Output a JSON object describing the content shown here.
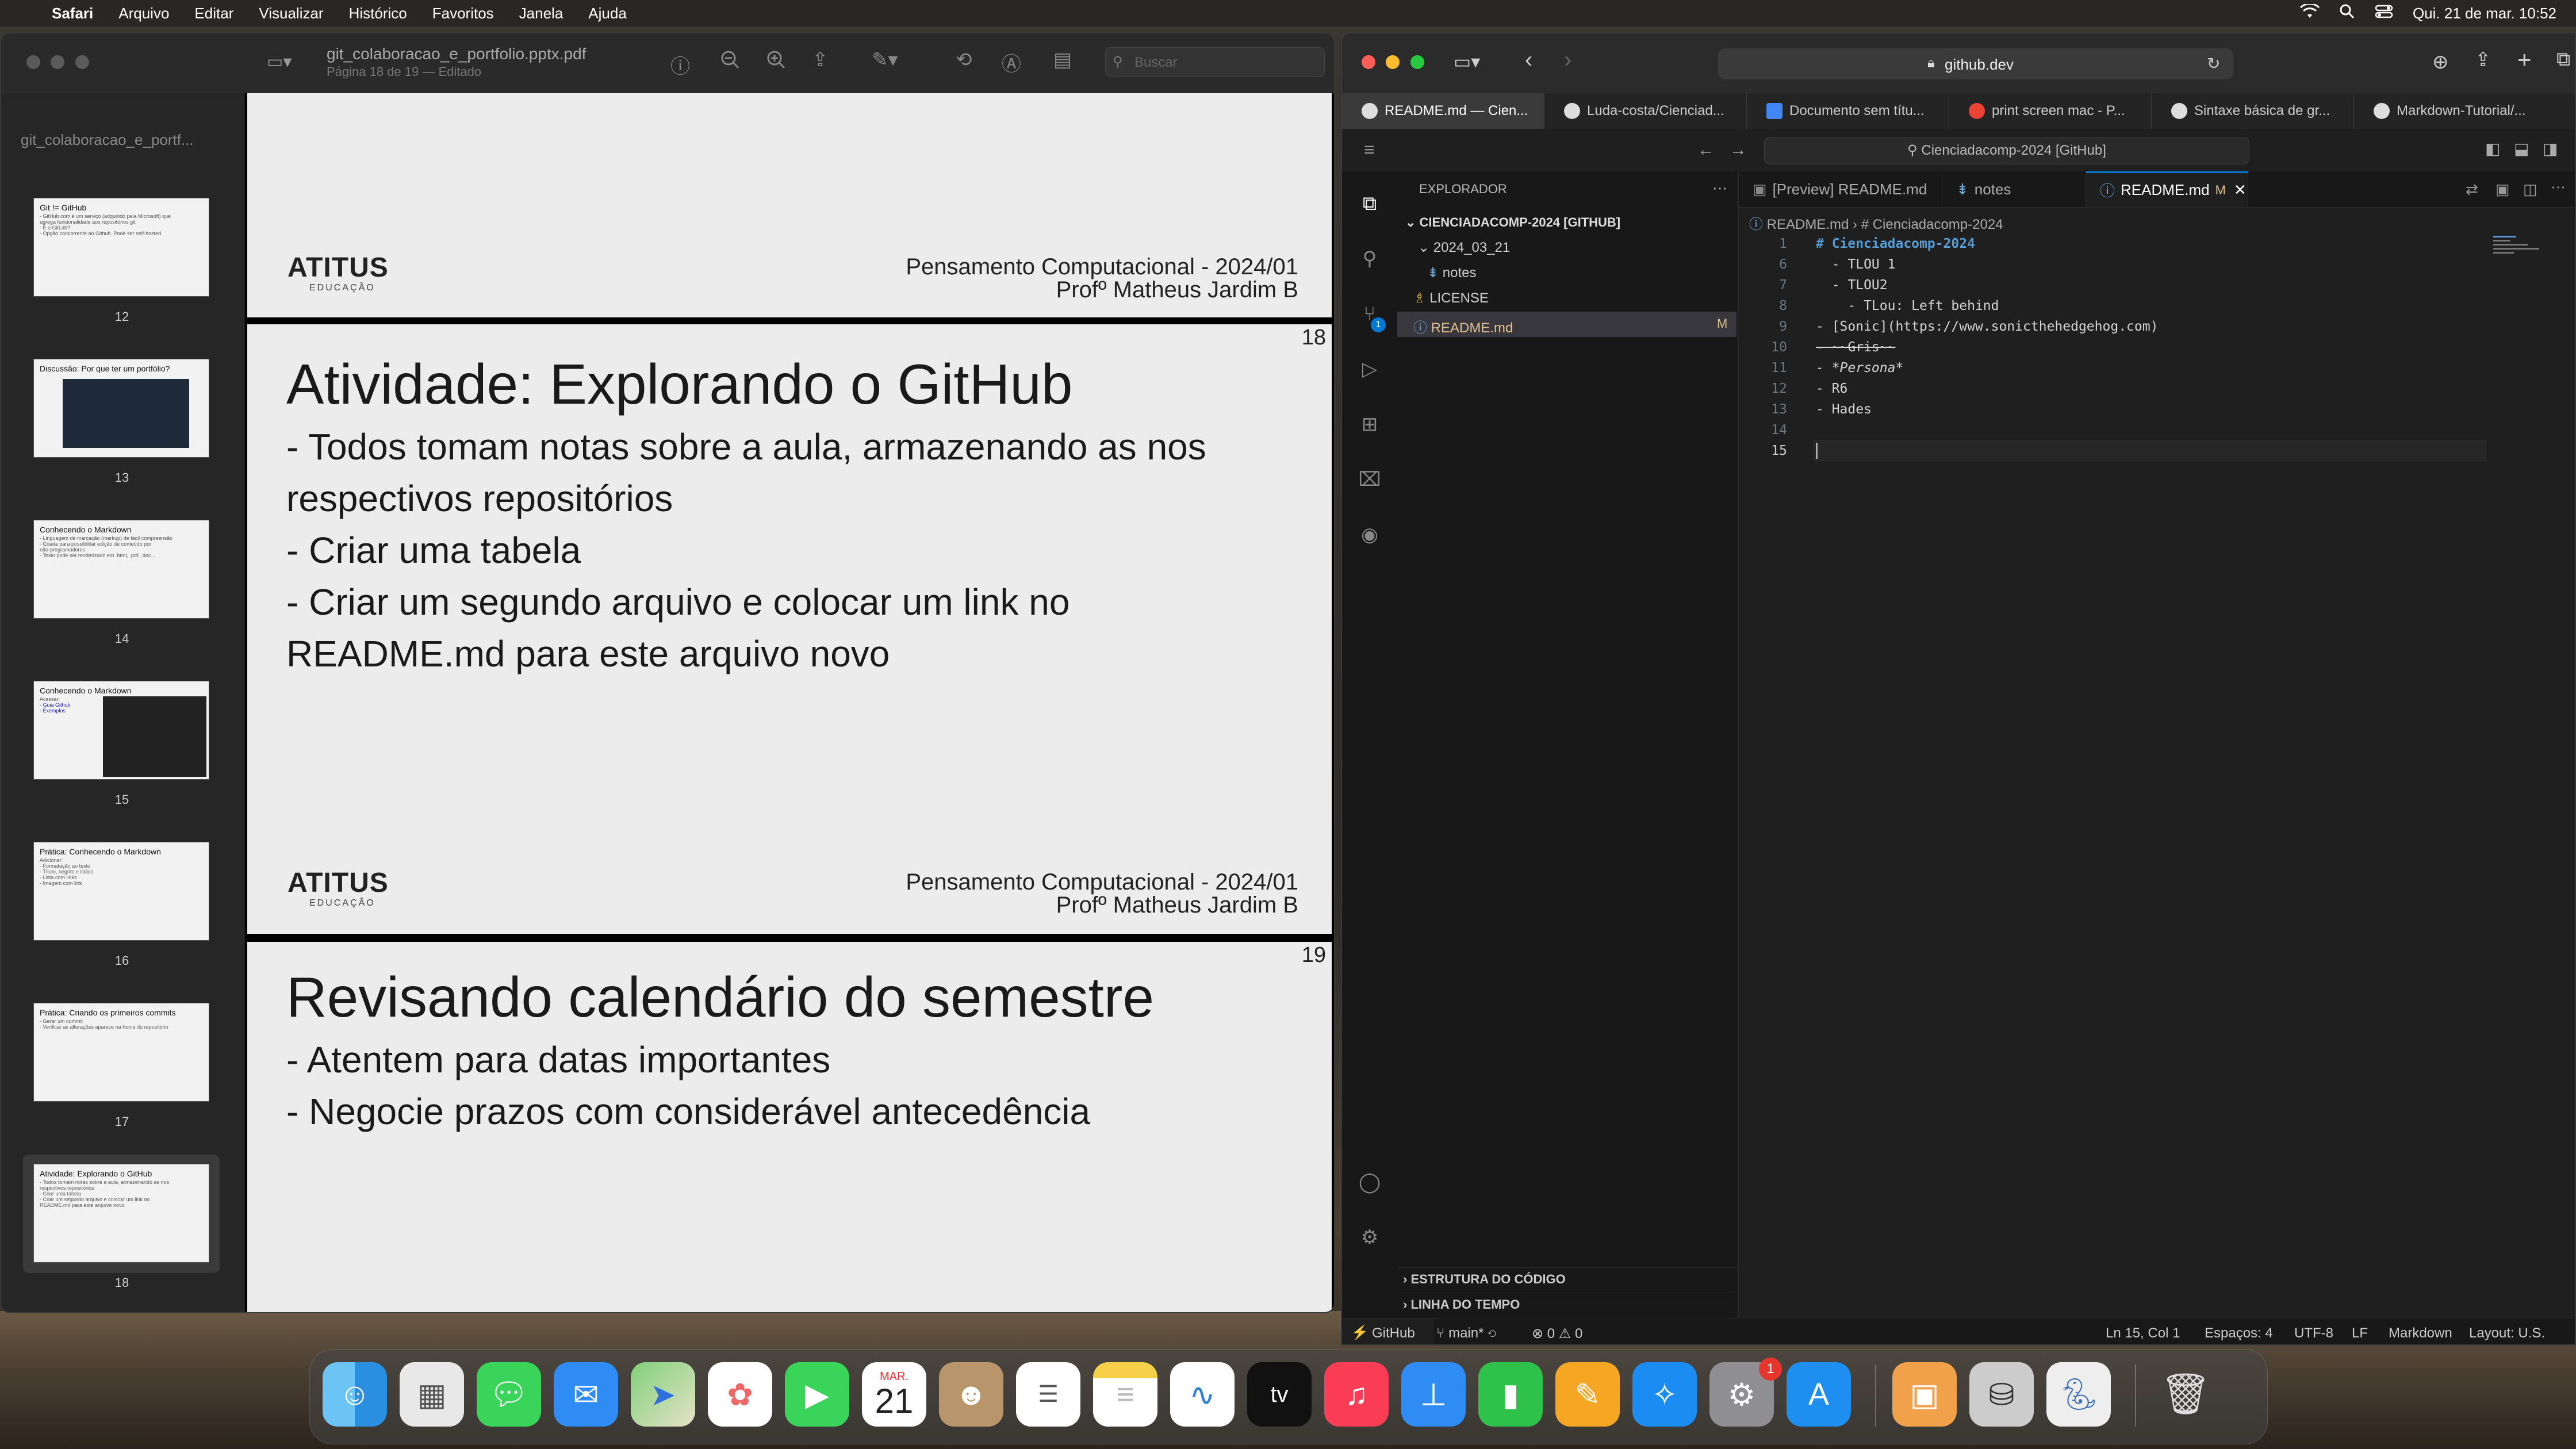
{
  "menubar": {
    "app": "Safari",
    "items": [
      "Arquivo",
      "Editar",
      "Visualizar",
      "Histórico",
      "Favoritos",
      "Janela",
      "Ajuda"
    ],
    "datetime": "Qui. 21 de mar.  10:52"
  },
  "preview": {
    "filename": "git_colaboracao_e_portfolio.pptx.pdf",
    "subtitle": "Página 18 de 19 — Editado",
    "sidebar_title": "git_colaboracao_e_portf...",
    "search_placeholder": "Buscar",
    "thumbnails": [
      {
        "num": "12",
        "title": "Git != GitHub",
        "lines": [
          "- GitHub com é um serviço (adquirido pela Microsoft) que",
          "  agrega funcionalidade aos repositórios git",
          "- E o GitLab?",
          "- Opção concorrente ao Github. Pode ser self-hosted"
        ]
      },
      {
        "num": "13",
        "title": "Discussão: Por que ter um portfólio?",
        "lines": []
      },
      {
        "num": "14",
        "title": "Conhecendo o Markdown",
        "lines": [
          "- Linguagem de marcação (markup) de fácil compreensão",
          "- Criada para possibilitar edição de conteúdo por",
          "  não-programadores",
          "- Texto pode ser renderizado em .html, .pdf, .doc..."
        ]
      },
      {
        "num": "15",
        "title": "Conhecendo o Markdown",
        "lines": [
          "Acessar:",
          "- Guia Github",
          "- Exemplos"
        ]
      },
      {
        "num": "16",
        "title": "Prática: Conhecendo o Markdown",
        "lines": [
          "Adicionar:",
          "- Formatação ao texto",
          "  - Título, negrito e itálico",
          "- Lista com links",
          "- Imagem com link"
        ]
      },
      {
        "num": "17",
        "title": "Prática: Criando os primeiros commits",
        "lines": [
          "- Gerar um commit",
          "- Verificar as alterações aparece na home do repositório"
        ]
      },
      {
        "num": "18",
        "title": "Atividade: Explorando o GitHub",
        "lines": [
          "- Todos tomam notas sobre a aula, armazenando as nos",
          "  respectivos repositórios",
          "- Criar uma tabela",
          "- Criar um segundo arquivo e colocar um link no",
          "  README.md para este arquivo novo"
        ]
      }
    ],
    "slide_prev_footer": {
      "logo": "ATITUS",
      "logo_sub": "EDUCAÇÃO",
      "course": "Pensamento Computacional - 2024/01",
      "teacher": "Profº Matheus Jardim B"
    },
    "slide18": {
      "page": "18",
      "title": "Atividade: Explorando o GitHub",
      "bullets": [
        "- Todos tomam notas sobre a aula, armazenando as nos",
        "  respectivos repositórios",
        "- Criar uma tabela",
        "- Criar um segundo arquivo e colocar um link no",
        "  README.md para este arquivo novo"
      ],
      "logo": "ATITUS",
      "logo_sub": "EDUCAÇÃO",
      "course": "Pensamento Computacional - 2024/01",
      "teacher": "Profº Matheus Jardim B"
    },
    "slide19": {
      "page": "19",
      "title": "Revisando calendário do semestre",
      "bullets": [
        "- Atentem para datas importantes",
        "- Negocie prazos com considerável antecedência"
      ]
    }
  },
  "safari": {
    "url": "github.dev",
    "tabs": [
      "README.md — Cien...",
      "Luda-costa/Cienciad...",
      "Documento sem títu...",
      "print screen mac - P...",
      "Sintaxe básica de gr...",
      "Markdown-Tutorial/..."
    ],
    "tab_favicon_colors": [
      "#ffffff",
      "#ffffff",
      "#4285f4",
      "#ea4335",
      "#ffffff",
      "#ffffff"
    ]
  },
  "vscode": {
    "command_center": "Cienciadacomp-2024 [GitHub]",
    "explorer_title": "EXPLORADOR",
    "repo": "CIENCIADACOMP-2024 [GITHUB]",
    "tree": [
      {
        "label": "2024_03_21",
        "type": "folder"
      },
      {
        "label": "notes",
        "type": "file"
      },
      {
        "label": "LICENSE",
        "type": "file"
      },
      {
        "label": "README.md",
        "type": "file",
        "status": "M"
      }
    ],
    "outline": "ESTRUTURA DO CÓDIGO",
    "timeline": "LINHA DO TEMPO",
    "tabs": [
      {
        "label": "[Preview] README.md"
      },
      {
        "label": "notes"
      },
      {
        "label": "README.md",
        "status": "M"
      }
    ],
    "breadcrumb_file": "README.md",
    "breadcrumb_symbol": "# Cienciadacomp-2024",
    "lines": [
      {
        "n": "1",
        "text": "# Cienciadacomp-2024"
      },
      {
        "n": "6",
        "text": "  - TLOU 1"
      },
      {
        "n": "7",
        "text": "  - TLOU2"
      },
      {
        "n": "8",
        "text": "    - TLou: Left behind"
      },
      {
        "n": "9",
        "text": "- [Sonic](https://www.sonicthehedgehog.com)"
      },
      {
        "n": "10",
        "text": "- ~~Gris~~"
      },
      {
        "n": "11",
        "text": "- *Persona*"
      },
      {
        "n": "12",
        "text": "- R6"
      },
      {
        "n": "13",
        "text": "- Hades"
      },
      {
        "n": "14",
        "text": ""
      },
      {
        "n": "15",
        "text": ""
      }
    ],
    "status": {
      "remote": "GitHub",
      "branch": "main*",
      "problems": "⊗ 0 ⚠ 0",
      "position": "Ln 15, Col 1",
      "spaces": "Espaços: 4",
      "encoding": "UTF-8",
      "eol": "LF",
      "language": "Markdown",
      "layout": "Layout: U.S."
    }
  },
  "dock": {
    "calendar_month": "MAR.",
    "calendar_day": "21",
    "settings_badge": "1",
    "apps": [
      "finder-icon",
      "launchpad-icon",
      "messages-icon",
      "mail-icon",
      "maps-icon",
      "photos-icon",
      "facetime-icon",
      "calendar-icon",
      "contacts-icon",
      "reminders-icon",
      "notes-icon",
      "freeform-icon",
      "tv-icon",
      "music-icon",
      "keynote-icon",
      "numbers-icon",
      "pages-icon",
      "safari-icon",
      "system-settings-icon",
      "app-store-icon",
      "preview-icon",
      "disk-utility-icon",
      "python-icon",
      "trash-icon"
    ]
  }
}
